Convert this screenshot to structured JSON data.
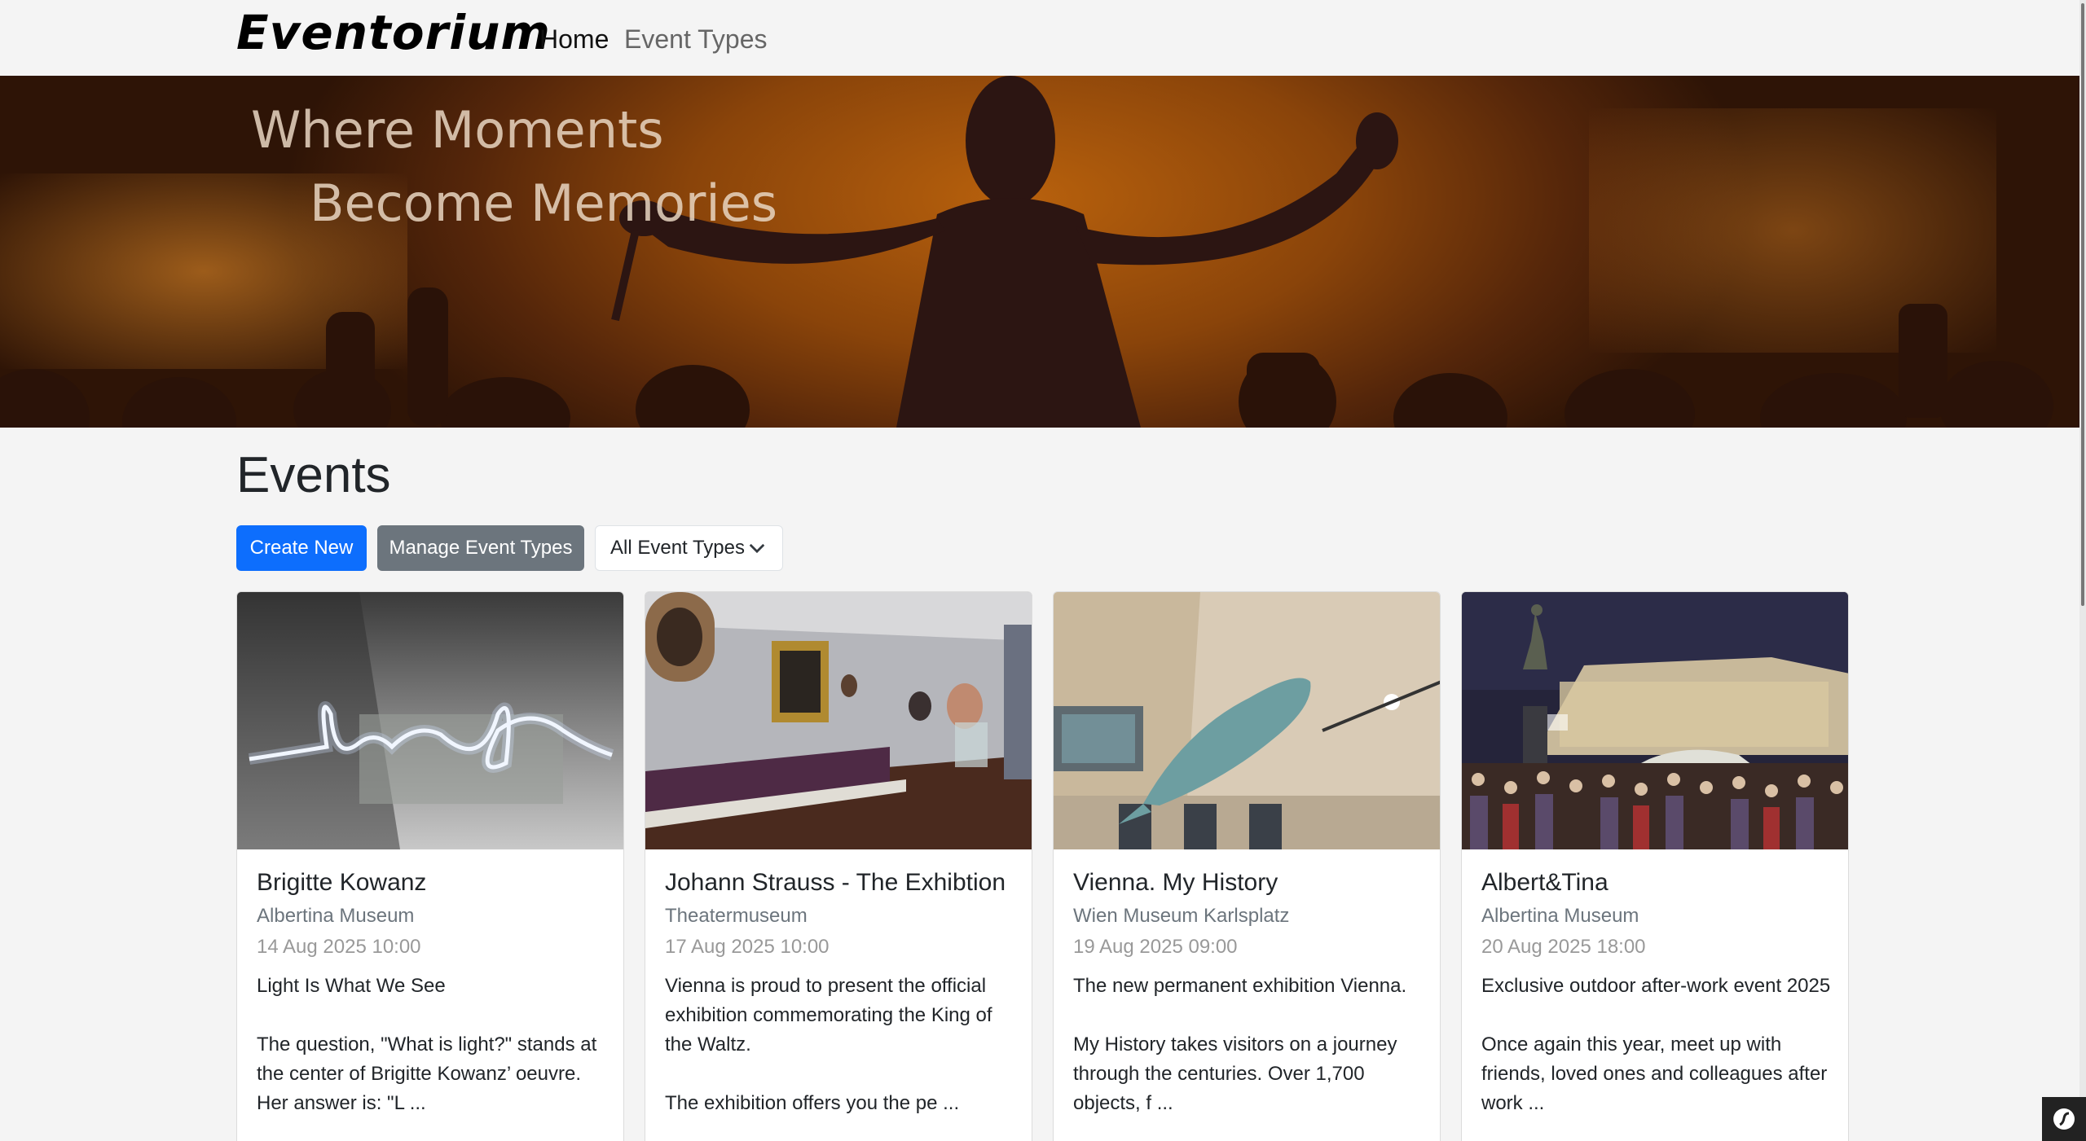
{
  "navbar": {
    "brand": "Eventorium",
    "links": [
      {
        "label": "Home"
      },
      {
        "label": "Event Types"
      }
    ]
  },
  "hero": {
    "line1": "Where Moments",
    "line2": "Become Memories"
  },
  "events": {
    "heading": "Events",
    "create_label": "Create New",
    "manage_label": "Manage Event Types",
    "filter_selected": "All Event Types",
    "cards": [
      {
        "title": "Brigitte Kowanz",
        "venue": "Albertina Museum",
        "date": "14 Aug 2025 10:00",
        "description": "Light Is What We See\n\nThe question, \"What is light?\" stands at the center of Brigitte Kowanz’ oeuvre. Her answer is: \"L ..."
      },
      {
        "title": "Johann Strauss - The Exhibtion",
        "venue": "Theatermuseum",
        "date": "17 Aug 2025 10:00",
        "description": "Vienna is proud to present the official exhibition commemorating the King of the Waltz.\n\nThe exhibition offers you the pe ..."
      },
      {
        "title": "Vienna. My History",
        "venue": "Wien Museum Karlsplatz",
        "date": "19 Aug 2025 09:00",
        "description": "The new permanent exhibition Vienna.\n\nMy History takes visitors on a journey through the centuries. Over 1,700 objects, f ..."
      },
      {
        "title": "Albert&Tina",
        "venue": "Albertina Museum",
        "date": "20 Aug 2025 18:00",
        "description": "Exclusive outdoor after-work event 2025\n\nOnce again this year, meet up with friends, loved ones and colleagues after work ..."
      }
    ]
  },
  "colors": {
    "primary": "#0d6efd",
    "secondary": "#6c757d",
    "hero_orange": "#b8610d"
  }
}
